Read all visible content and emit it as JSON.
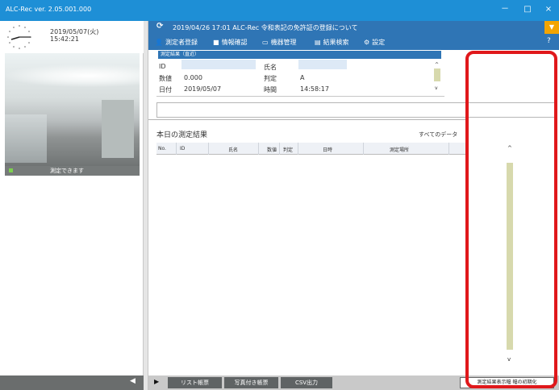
{
  "app": {
    "title": "ALC-Rec ver. 2.05.001.000"
  },
  "window_controls": {
    "minimize": "－",
    "maximize": "□",
    "close": "×"
  },
  "sidebar": {
    "date": "2019/05/07(火)",
    "time": "15:42:21",
    "camera_status": "測定できます",
    "collapse_arrow": "◀"
  },
  "header": {
    "reload_icon": "⟳",
    "notice": "2019/04/26 17:01 ALC-Rec 令和表記の免許証の登録について",
    "dropdown_icon": "▼"
  },
  "menu": {
    "items": [
      {
        "icon": "person-icon",
        "glyph": "👤",
        "label": "測定者登録"
      },
      {
        "icon": "book-icon",
        "glyph": "■",
        "label": "情報確認"
      },
      {
        "icon": "device-icon",
        "glyph": "▭",
        "label": "機器管理"
      },
      {
        "icon": "calendar-icon",
        "glyph": "▤",
        "label": "結果検索"
      },
      {
        "icon": "gear-icon",
        "glyph": "⚙",
        "label": "設定"
      }
    ],
    "help": "?"
  },
  "result": {
    "panel_title": "測定結果（直近）",
    "fields": {
      "id_label": "ID",
      "id_value": "",
      "name_label": "氏名",
      "name_value": "",
      "value_label": "数値",
      "value_value": "0.000",
      "judgement_label": "判定",
      "judgement_value": "A",
      "date_label": "日付",
      "date_value": "2019/05/07",
      "time_label": "時間",
      "time_value": "14:58:17"
    }
  },
  "search": {
    "value": ""
  },
  "today": {
    "title": "本日の測定結果",
    "filter_label": "すべてのデータ",
    "filter_caret": "▾",
    "columns": [
      "No.",
      "ID",
      "氏名",
      "数値",
      "判定",
      "日時",
      "測定場所"
    ]
  },
  "footer": {
    "play": "▶",
    "buttons": [
      "リスト帳票",
      "写真付き帳票",
      "CSV出力"
    ],
    "reset": "測定結果表示幅 幅の初期化"
  },
  "colors": {
    "title_bar": "#1e8fd6",
    "menu_bar": "#2f75b5",
    "accent": "#f3a400",
    "highlight": "#e0181b"
  }
}
